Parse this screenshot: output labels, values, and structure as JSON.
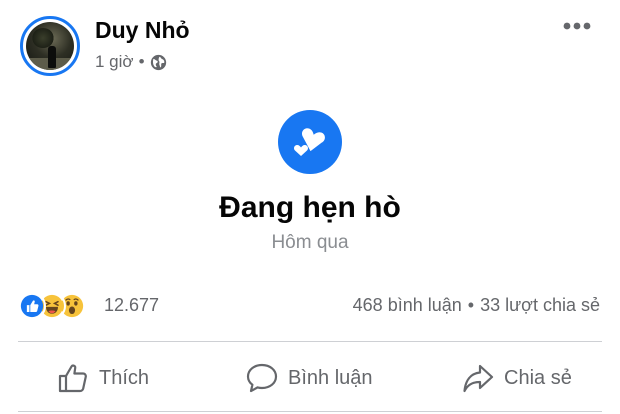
{
  "post": {
    "author_name": "Duy Nhỏ",
    "time": "1 giờ",
    "separator": "•",
    "privacy_icon": "globe-icon",
    "menu_icon": "more-icon"
  },
  "life_event": {
    "icon": "hearts-icon",
    "title": "Đang hẹn hò",
    "date": "Hôm qua",
    "accent_color": "#1877f2"
  },
  "stats": {
    "reaction_icons": [
      "like-icon",
      "haha-icon",
      "wow-icon"
    ],
    "reaction_count": "12.677",
    "comments": "468 bình luận",
    "separator": "•",
    "shares": "33 lượt chia sẻ"
  },
  "actions": {
    "like_label": "Thích",
    "comment_label": "Bình luận",
    "share_label": "Chia sẻ"
  },
  "colors": {
    "brand_blue": "#1877f2",
    "secondary_text": "#65676b",
    "divider": "#ced0d4"
  }
}
